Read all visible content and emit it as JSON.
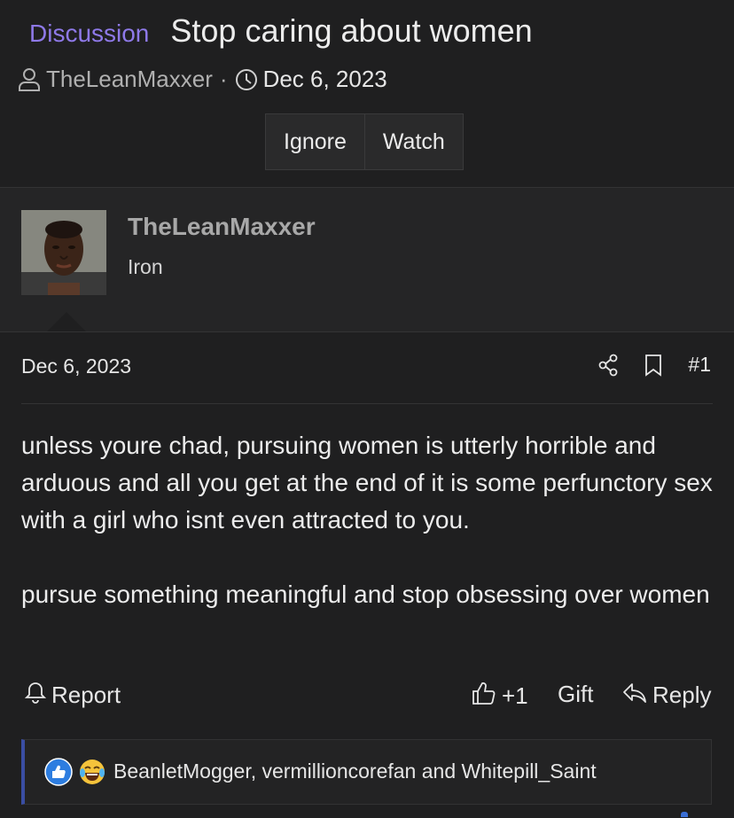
{
  "thread": {
    "prefix": "Discussion",
    "title": "Stop caring about women",
    "author": "TheLeanMaxxer",
    "separator": "·",
    "date": "Dec 6, 2023",
    "buttons": {
      "ignore": "Ignore",
      "watch": "Watch"
    }
  },
  "post": {
    "username": "TheLeanMaxxer",
    "rank": "Iron",
    "date": "Dec 6, 2023",
    "number": "#1",
    "body": [
      "unless youre chad, pursuing women is utterly horrible and arduous and all you get at the end of it is some perfunctory sex with a girl who isnt even attracted to you.",
      "pursue something meaningful and stop obsessing over women"
    ],
    "actions": {
      "report": "Report",
      "like_count": "+1",
      "gift": "Gift",
      "reply": "Reply"
    },
    "reactions": {
      "names": "BeanletMogger, vermillioncorefan and Whitepill_Saint"
    }
  },
  "colors": {
    "background": "#1f1f20",
    "prefix": "#8e79e8",
    "accent_border": "#3a4ea3",
    "like_blue": "#2d7de0"
  },
  "icons": [
    "user-icon",
    "clock-icon",
    "share-icon",
    "bookmark-icon",
    "bell-icon",
    "thumbs-up-icon",
    "reply-icon",
    "like-reaction-icon",
    "laugh-cry-reaction-icon"
  ]
}
